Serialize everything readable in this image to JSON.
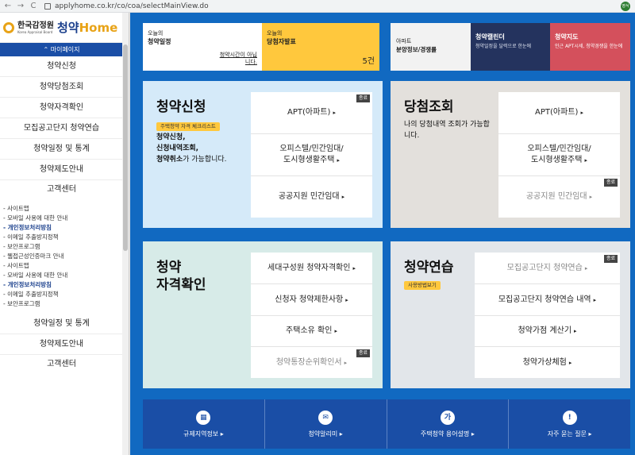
{
  "browser": {
    "url": "applyhome.co.kr/co/coa/selectMainView.do",
    "back": "←",
    "forward": "→",
    "reload": "C",
    "profile": "영식"
  },
  "sidebar": {
    "logo_ko": "한국감정원",
    "logo_en": "Korea Appraisal Board",
    "logo_home_a": "청약",
    "logo_home_b": "Home",
    "mypage": "마이페이지",
    "menu": [
      "청약신청",
      "청약당첨조회",
      "청약자격확인",
      "모집공고단지 청약연습",
      "청약일정 및 통계",
      "청약제도안내",
      "고객센터"
    ],
    "sub_links": [
      "사이트맵",
      "모바일 사용에 대한 안내",
      "개인정보처리방침",
      "이메일 추출방지정책",
      "보안프로그램",
      "웹접근성인증마크 안내"
    ],
    "menu2": [
      "청약일정 및 통계",
      "청약제도안내",
      "고객센터"
    ],
    "sub_links2": [
      "사이트맵",
      "모바일 사용에 대한 안내",
      "개인정보처리방침",
      "이메일 추출방지정책",
      "보안프로그램"
    ]
  },
  "top_cards": {
    "today_small": "오늘의",
    "today_bold": "청약일정",
    "today_link": "청약시간이 아닙니다.",
    "winner_small": "오늘의",
    "winner_bold": "당첨자발표",
    "winner_count": "5건",
    "apt_small": "아파트",
    "apt_bold": "분양정보/경쟁률",
    "calendar_title": "청약캘린더",
    "calendar_desc": "청약일정을 달력으로 한눈에",
    "map_title": "청약지도",
    "map_desc": "인근 APT시세, 청약경쟁을 한눈에"
  },
  "sections": {
    "apply": {
      "title": "청약신청",
      "tag": "주택청약 자격 체크리스트",
      "desc_1": "청약신청,",
      "desc_2": "신청내역조회,",
      "desc_3a": "청약취소",
      "desc_3b": "가 가능합니다.",
      "items": [
        "APT(아파트)",
        "오피스텔/민간임대/",
        "도시형생활주택",
        "공공지원 민간임대"
      ],
      "closed": "종료"
    },
    "winner": {
      "title": "당첨조회",
      "desc": "나의 당첨내역 조회가 가능합니다.",
      "items": [
        "APT(아파트)",
        "오피스텔/민간임대/",
        "도시형생활주택",
        "공공지원 민간임대"
      ],
      "closed": "종료"
    },
    "qualify": {
      "title_1": "청약",
      "title_2": "자격확인",
      "items": [
        "세대구성원 청약자격확인",
        "신청자 청약제한사항",
        "주택소유 확인",
        "청약통장순위확인서"
      ],
      "closed": "종료"
    },
    "practice": {
      "title": "청약연습",
      "tag": "사용방법보기",
      "items": [
        "모집공고단지 청약연습",
        "모집공고단지 청약연습 내역",
        "청약가점 계산기",
        "청약가상체험"
      ],
      "closed": "종료"
    }
  },
  "quick_links": [
    {
      "icon": "▦",
      "label": "규제지역정보"
    },
    {
      "icon": "✉",
      "label": "청약알리미"
    },
    {
      "icon": "가",
      "label": "주택청약 용어설명"
    },
    {
      "icon": "!",
      "label": "자주 묻는 질문"
    }
  ]
}
